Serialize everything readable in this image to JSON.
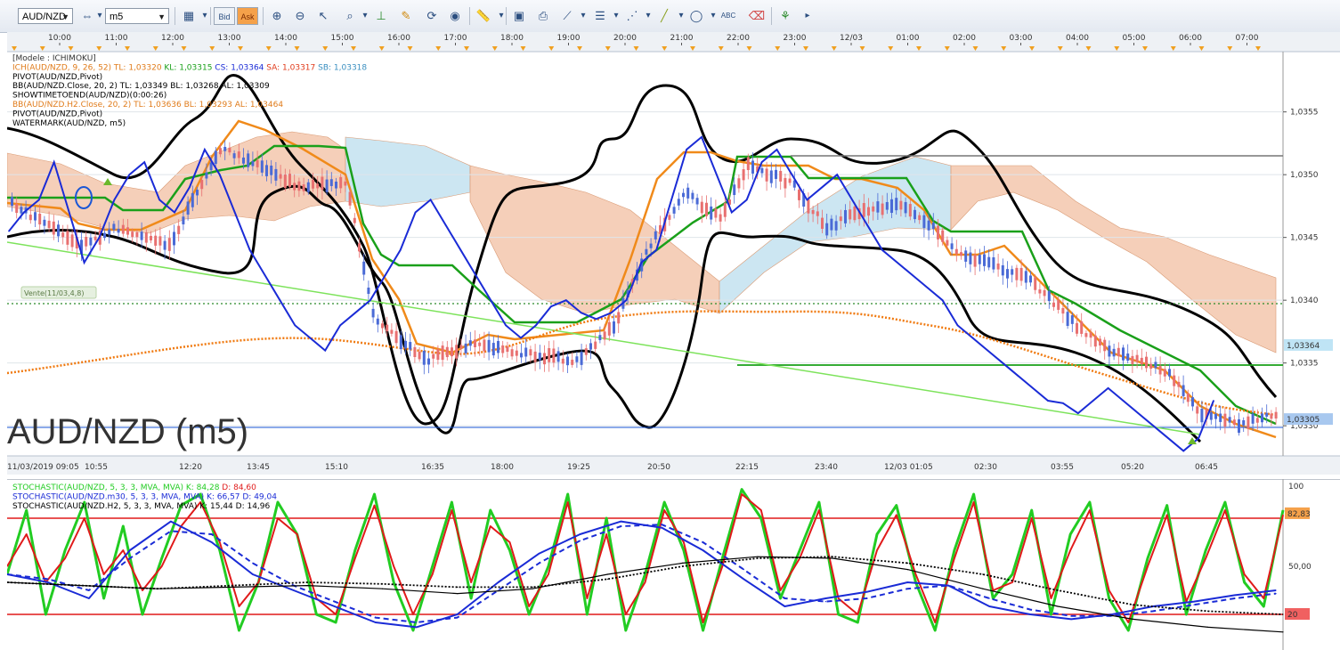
{
  "toolbar": {
    "symbol": "AUD/NZD",
    "timeframe": "m5",
    "bid_label": "Bid",
    "ask_label": "Ask",
    "icons": [
      "crosshair-icon",
      "chart-type-icon",
      "zoom-in-icon",
      "zoom-out-icon",
      "cursor-icon",
      "zoom-area-icon",
      "vertical-line-icon",
      "note-icon",
      "refresh-icon",
      "globe-icon",
      "ruler-icon",
      "image-icon",
      "print-icon",
      "trendline-icon",
      "list-icon",
      "fan-icon",
      "line-draw-icon",
      "ellipse-icon",
      "text-icon",
      "eraser-icon",
      "tree-icon"
    ]
  },
  "chart_data": [
    {
      "type": "line",
      "title": "AUD/NZD (m5)",
      "top_axis_labels": [
        "10:00",
        "11:00",
        "12:00",
        "13:00",
        "14:00",
        "15:00",
        "16:00",
        "17:00",
        "18:00",
        "19:00",
        "20:00",
        "21:00",
        "22:00",
        "23:00",
        "12/03",
        "01:00",
        "02:00",
        "03:00",
        "04:00",
        "05:00",
        "06:00",
        "07:00"
      ],
      "bottom_axis_labels": [
        "11/03/2019 09:05",
        "10:55",
        "12:20",
        "13:45",
        "15:10",
        "16:35",
        "18:00",
        "19:25",
        "20:50",
        "22:15",
        "23:40",
        "12/03 01:05",
        "02:30",
        "03:55",
        "05:20",
        "06:45"
      ],
      "y_ticks": [
        "1,0355",
        "1,0350",
        "1,0345",
        "1,0340",
        "1,0335",
        "1,0330"
      ],
      "ylim": [
        1.03276,
        1.03598
      ],
      "current_price_labels": [
        "1,03364",
        "1,03305"
      ],
      "indicator_lines": [
        {
          "text": "[Modele : ICHIMOKU]",
          "color": "#333333"
        },
        {
          "text": "ICH(AUD/NZD, 9, 26, 52)",
          "color": "#e07b1a",
          "values": [
            {
              "text": "TL: 1,03320",
              "color": "#e07b1a"
            },
            {
              "text": "KL: 1,03315",
              "color": "#1aa01a"
            },
            {
              "text": "CS: 1,03364",
              "color": "#1a2bd6"
            },
            {
              "text": "SA: 1,03317",
              "color": "#e03a1a"
            },
            {
              "text": "SB: 1,03318",
              "color": "#3a8fc0"
            }
          ]
        },
        {
          "text": "PIVOT(AUD/NZD,Pivot)",
          "color": "#000000"
        },
        {
          "text": "BB(AUD/NZD.Close, 20, 2)  TL: 1,03349  BL: 1,03268  AL: 1,03309",
          "color": "#000000"
        },
        {
          "text": "SHOWTIMETOEND(AUD/NZD)(0:00:26)",
          "color": "#000000"
        },
        {
          "text": "BB(AUD/NZD.H2.Close, 20, 2)  TL: 1,03636  BL: 1,03293  AL: 1,03464",
          "color": "#e07b1a"
        },
        {
          "text": "PIVOT(AUD/NZD,Pivot)",
          "color": "#000000"
        },
        {
          "text": "WATERMARK(AUD/NZD, m5)",
          "color": "#000000"
        }
      ],
      "annotation": "Vente(11/03,4,8)",
      "series": [
        {
          "name": "Close",
          "color": "#1a2bd6",
          "values": [
            1.03455,
            1.0347,
            1.0348,
            1.0351,
            1.0347,
            1.0343,
            1.0345,
            1.0348,
            1.035,
            1.0351,
            1.0348,
            1.0347,
            1.0349,
            1.0352,
            1.035,
            1.0347,
            1.0344,
            1.0342,
            1.034,
            1.0338,
            1.0337,
            1.0336,
            1.0338,
            1.0339,
            1.034,
            1.0342,
            1.0344,
            1.0347,
            1.0348,
            1.0346,
            1.0344,
            1.0342,
            1.034,
            1.0338,
            1.0337,
            1.0338,
            1.03395,
            1.034,
            1.0339,
            1.03385,
            1.0339,
            1.034,
            1.0343,
            1.0344,
            1.0348,
            1.0352,
            1.0353,
            1.035,
            1.0347,
            1.0348,
            1.0351,
            1.0352,
            1.035,
            1.0348,
            1.0349,
            1.035,
            1.0348,
            1.0346,
            1.0344,
            1.0343,
            1.0342,
            1.0341,
            1.034,
            1.0338,
            1.0337,
            1.0336,
            1.0335,
            1.0334,
            1.0333,
            1.0332,
            1.03318,
            1.0331,
            1.0332,
            1.0333,
            1.0332,
            1.0331,
            1.033,
            1.0329,
            1.0328,
            1.0329,
            1.0332
          ]
        }
      ]
    },
    {
      "type": "line",
      "legend": [
        {
          "text": "STOCHASTIC(AUD/NZD, 5, 3, 3, MVA, MVA)",
          "color": "#22cc22",
          "values": [
            {
              "text": "K: 84,28",
              "color": "#22cc22"
            },
            {
              "text": "D: 84,60",
              "color": "#e01a1a"
            }
          ]
        },
        {
          "text": "STOCHASTIC(AUD/NZD.m30, 5, 3, 3, MVA, MVA)",
          "color": "#1a2bd6",
          "values": [
            {
              "text": "K: 66,57",
              "color": "#1a2bd6"
            },
            {
              "text": "D: 49,04",
              "color": "#1a2bd6"
            }
          ]
        },
        {
          "text": "STOCHASTIC(AUD/NZD.H2, 5, 3, 3, MVA, MVA)",
          "color": "#000000",
          "values": [
            {
              "text": "K: 15,44",
              "color": "#000000"
            },
            {
              "text": "D: 14,96",
              "color": "#000000"
            }
          ]
        }
      ],
      "ylim": [
        0,
        100
      ],
      "y_ticks": [
        "100",
        "50,00"
      ],
      "levels": [
        80,
        20
      ],
      "level_labels": [
        "82,83",
        "20"
      ],
      "series": [
        {
          "name": "K m5",
          "color": "#22cc22",
          "values": [
            45,
            85,
            20,
            60,
            90,
            30,
            75,
            20,
            55,
            88,
            95,
            60,
            10,
            40,
            90,
            70,
            20,
            15,
            60,
            95,
            40,
            10,
            50,
            90,
            30,
            85,
            60,
            20,
            50,
            95,
            20,
            80,
            10,
            45,
            90,
            60,
            10,
            55,
            98,
            80,
            30,
            60,
            90,
            20,
            15,
            70,
            88,
            40,
            10,
            60,
            95,
            30,
            45,
            85,
            20,
            70,
            90,
            30,
            10,
            55,
            88,
            20,
            60,
            90,
            40,
            25,
            85
          ]
        },
        {
          "name": "D m5",
          "color": "#e01a1a",
          "values": [
            50,
            70,
            40,
            55,
            80,
            45,
            60,
            35,
            50,
            75,
            90,
            65,
            25,
            40,
            80,
            70,
            30,
            20,
            55,
            88,
            50,
            20,
            45,
            85,
            40,
            75,
            65,
            25,
            45,
            90,
            30,
            70,
            20,
            40,
            85,
            65,
            15,
            50,
            95,
            85,
            35,
            55,
            85,
            30,
            20,
            60,
            82,
            45,
            15,
            55,
            90,
            35,
            40,
            80,
            30,
            60,
            85,
            35,
            15,
            50,
            82,
            28,
            55,
            85,
            45,
            30,
            82
          ]
        },
        {
          "name": "K m30",
          "color": "#1a2bd6",
          "values": [
            45,
            40,
            30,
            60,
            78,
            65,
            45,
            35,
            25,
            15,
            12,
            20,
            40,
            58,
            70,
            78,
            74,
            60,
            42,
            25,
            30,
            34,
            40,
            38,
            25,
            20,
            17,
            20,
            25,
            28,
            32,
            35
          ]
        },
        {
          "name": "D m30",
          "color": "#1a2bd6",
          "values": [
            45,
            42,
            35,
            55,
            72,
            70,
            52,
            38,
            28,
            18,
            15,
            18,
            35,
            52,
            66,
            75,
            76,
            65,
            48,
            30,
            28,
            30,
            36,
            38,
            30,
            23,
            19,
            19,
            22,
            26,
            30,
            33
          ]
        },
        {
          "name": "K H2",
          "color": "#000000",
          "values": [
            40,
            38,
            36,
            37,
            38,
            36,
            33,
            36,
            45,
            52,
            56,
            55,
            48,
            36,
            25,
            17,
            12,
            9
          ]
        },
        {
          "name": "D H2",
          "color": "#000000",
          "values": [
            40,
            38,
            36,
            38,
            40,
            39,
            37,
            37,
            42,
            50,
            55,
            56,
            52,
            45,
            35,
            26,
            22,
            20
          ]
        }
      ]
    }
  ]
}
